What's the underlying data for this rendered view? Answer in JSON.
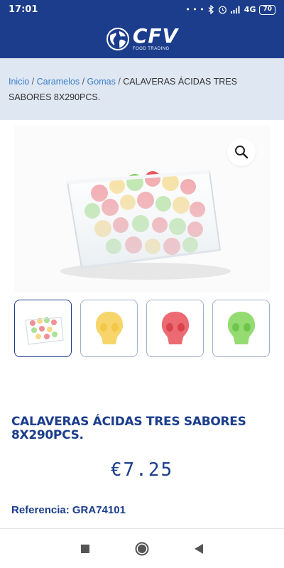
{
  "status_bar": {
    "time": "17:01",
    "network": "4G",
    "battery": "70"
  },
  "header": {
    "logo_text": "CFV",
    "logo_subtext": "FOOD TRADING",
    "brand_color": "#1b3d8c"
  },
  "breadcrumb": {
    "items": [
      "Inicio",
      "Caramelos",
      "Gomas"
    ],
    "separator": "/",
    "current": "CALAVERAS ÁCIDAS TRES SABORES 8X290PCS."
  },
  "product": {
    "title": "CALAVERAS ÁCIDAS TRES SABORES 8X290PCS.",
    "price": "€7.25",
    "reference_label": "Referencia:",
    "reference_value": "GRA74101"
  },
  "gallery": {
    "zoom_icon": "search-icon",
    "thumbnails": [
      {
        "name": "tub-of-candy",
        "color": "#e9edf1"
      },
      {
        "name": "yellow-skull",
        "color": "#f7d56a"
      },
      {
        "name": "red-skull",
        "color": "#e8555f"
      },
      {
        "name": "green-skull",
        "color": "#8cd86a"
      }
    ]
  },
  "nav_bar": {
    "icons": [
      "recent-apps-icon",
      "home-icon",
      "back-icon"
    ]
  }
}
